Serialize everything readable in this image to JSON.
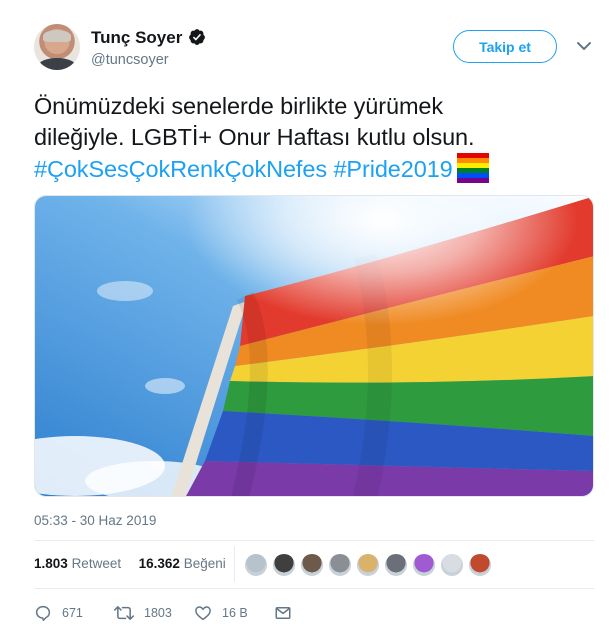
{
  "author": {
    "name": "Tunç Soyer",
    "handle": "@tuncsoyer",
    "verified": true
  },
  "follow_button": {
    "label": "Takip et"
  },
  "tweet": {
    "line1": "Önümüzdeki senelerde birlikte yürümek",
    "line2": "dileğiyle. LGBTİ+ Onur Haftası kutlu olsun.",
    "hashtag1": "#ÇokSesÇokRenkÇokNefes",
    "hashtag2": "#Pride2019",
    "emoji": "rainbow-flag-emoji"
  },
  "media": {
    "description_icon": "rainbow-flag-photo"
  },
  "timestamp": "05:33 - 30 Haz 2019",
  "stats": {
    "retweet_count": "1.803",
    "retweet_label": "Retweet",
    "like_count": "16.362",
    "like_label": "Beğeni"
  },
  "liker_avatars": [
    {
      "color": "#b7c3cc"
    },
    {
      "color": "#3f3f3f"
    },
    {
      "color": "#6d5a4a"
    },
    {
      "color": "#8a8f96"
    },
    {
      "color": "#d9b26b"
    },
    {
      "color": "#6b7078"
    },
    {
      "color": "#a05bd0"
    },
    {
      "color": "#d7dde2"
    },
    {
      "color": "#c04a2e"
    }
  ],
  "actions": {
    "reply_count": "671",
    "retweet_count": "1803",
    "like_count": "16 B"
  },
  "colors": {
    "accent": "#1da1f2",
    "secondary_text": "#657786",
    "primary_text": "#14171a"
  }
}
